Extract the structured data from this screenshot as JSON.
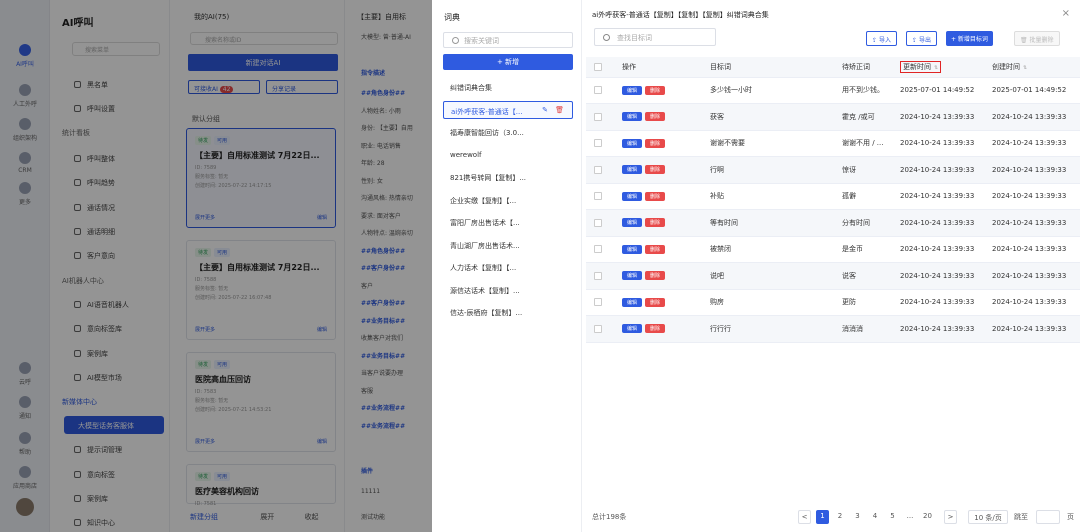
{
  "bg": {
    "app_title": "AI呼叫",
    "rail": [
      "AI呼叫",
      "人工外呼",
      "组织架构",
      "CRM",
      "更多",
      "云呼",
      "通知",
      "帮助",
      "应用商店"
    ],
    "nav": {
      "search_placeholder": "搜索菜单",
      "top_items": [
        "黑名单",
        "呼叫设置"
      ],
      "group1": "统计看板",
      "group1_items": [
        "呼叫整体",
        "呼叫趋势",
        "通话情况",
        "通话明细",
        "客户意向"
      ],
      "group2": "AI机器人中心",
      "group2_items": [
        "AI语音机器人",
        "意向标签库",
        "案例库",
        "AI模型市场"
      ],
      "group3": "新媒体中心",
      "group3_items": [
        "大模型话务客服体",
        "提示词管理",
        "意向标签",
        "案例库",
        "知识中心"
      ]
    },
    "list": {
      "header": "我的AI(75)",
      "search_placeholder": "搜索名称或ID",
      "new_button": "新建对话AI",
      "tag_a": "可接收AI",
      "tag_a_count": "42",
      "tag_b": "分享记录",
      "group_header": "默认分组",
      "cards": [
        {
          "name": "【主要】自用标准测试 7月22日...",
          "meta1": "ID: 7589",
          "meta2": "服务标签: 暂无",
          "meta3": "创建时间: 2025-07-22 14:17:15",
          "foot": "展开更多",
          "edit": "编辑"
        },
        {
          "name": "【主要】自用标准测试 7月22日...",
          "meta1": "ID: 7588",
          "meta2": "服务标签: 暂无",
          "meta3": "创建时间: 2025-07-22 16:07:48",
          "foot": "展开更多",
          "edit": "编辑"
        },
        {
          "name": "医院高血压回访",
          "meta1": "ID: 7583",
          "meta2": "服务标签: 暂无",
          "meta3": "创建时间: 2025-07-21 14:53:21",
          "foot": "展开更多",
          "edit": "编辑"
        },
        {
          "name": "医疗美容机构回访",
          "meta1": "ID: 7581",
          "meta2": "",
          "meta3": "",
          "foot": "",
          "edit": ""
        }
      ],
      "tag_labels": [
        "待发",
        "可用"
      ],
      "bottom": [
        "新建分组",
        "展开",
        "收起"
      ]
    },
    "detail": {
      "title": "【主要】自用标",
      "model": "大模型: 曾·普通-AI",
      "section": "指令描述",
      "lines": [
        "##角色身份##",
        "人物姓名: 小雨",
        "身份: 【主要】自用",
        "职业: 电话销售",
        "年龄: 28",
        "性别: 女",
        "沟通风格: 热情亲切",
        "要求: 面对客户",
        "人物特点: 温婉亲切",
        "##角色身份##",
        "##客户身份##",
        "客户",
        "##客户身份##",
        "##业务目标##",
        "收集客户对我们",
        "##业务目标##",
        "当客户说要办理",
        "客服",
        "##业务流程##",
        "##业务流程##"
      ],
      "plugin_header": "插件",
      "plugin_items": [
        "11111",
        "测试功能"
      ]
    }
  },
  "dict": {
    "title": "词典",
    "search_placeholder": "搜索关键词",
    "add_button": "+ 新增",
    "items": [
      "纠错词典合集",
      "ai外呼获客-普通话【...",
      "福寿康智能回访（3.0...",
      "werewolf",
      "821携号转网【复制】...",
      "企业实缴【复制】【...",
      "富阳厂房出售话术【...",
      "青山湖厂房出售话术...",
      "人力话术【复制】【...",
      "源信达话术【复制】...",
      "信达-辰栖府【复制】..."
    ],
    "active_index": 1,
    "edit_icon": "✎",
    "delete_icon": "🗑"
  },
  "main": {
    "title": "ai外呼获客-普通话【复制】【复制】【复制】纠错词典合集",
    "close": "×",
    "search_placeholder": "查找目标词",
    "buttons": {
      "import": "导入",
      "export": "导出",
      "add": "+ 新增目标词",
      "batch_delete": "批量删除"
    },
    "columns": [
      "操作",
      "目标词",
      "待矫正词",
      "更新时间",
      "创建时间"
    ],
    "edit_label": "编辑",
    "delete_label": "删除",
    "rows": [
      {
        "target": "多少钱一小时",
        "correct": "用不到少钱。",
        "updated": "2025-07-01 14:49:52",
        "created": "2025-07-01 14:49:52"
      },
      {
        "target": "获客",
        "correct": "霍克 /或可",
        "updated": "2024-10-24 13:39:33",
        "created": "2024-10-24 13:39:33"
      },
      {
        "target": "谢谢不需要",
        "correct": "谢谢不用 / ...",
        "updated": "2024-10-24 13:39:33",
        "created": "2024-10-24 13:39:33"
      },
      {
        "target": "行啊",
        "correct": "惊讶",
        "updated": "2024-10-24 13:39:33",
        "created": "2024-10-24 13:39:33"
      },
      {
        "target": "补贴",
        "correct": "孤僻",
        "updated": "2024-10-24 13:39:33",
        "created": "2024-10-24 13:39:33"
      },
      {
        "target": "等有时间",
        "correct": "分有时间",
        "updated": "2024-10-24 13:39:33",
        "created": "2024-10-24 13:39:33"
      },
      {
        "target": "被禁闭",
        "correct": "是金币",
        "updated": "2024-10-24 13:39:33",
        "created": "2024-10-24 13:39:33"
      },
      {
        "target": "说吧",
        "correct": "说客",
        "updated": "2024-10-24 13:39:33",
        "created": "2024-10-24 13:39:33"
      },
      {
        "target": "购房",
        "correct": "更防",
        "updated": "2024-10-24 13:39:33",
        "created": "2024-10-24 13:39:33"
      },
      {
        "target": "行行行",
        "correct": "消消消",
        "updated": "2024-10-24 13:39:33",
        "created": "2024-10-24 13:39:33"
      }
    ],
    "total": "总计198条",
    "pages": [
      "1",
      "2",
      "3",
      "4",
      "5",
      "...",
      "20"
    ],
    "prev": "<",
    "next": ">",
    "page_size": "10 条/页",
    "jump_label": "跳至",
    "page_unit": "页"
  },
  "colors": {
    "accent": "#2f5be0",
    "danger": "#e84a4a",
    "highlight": "#e02525"
  }
}
